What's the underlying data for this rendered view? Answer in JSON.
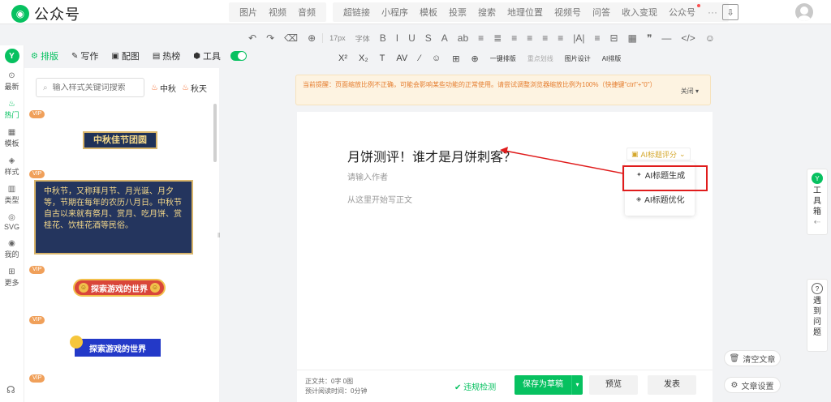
{
  "brand": {
    "name": "公众号"
  },
  "topnav": {
    "group1": [
      "图片",
      "视频",
      "音频"
    ],
    "group2": [
      "超链接",
      "小程序",
      "模板",
      "投票",
      "搜索",
      "地理位置",
      "视频号",
      "问答",
      "收入变现",
      "公众号"
    ],
    "more": "···"
  },
  "toolbar1": {
    "font_size": "17px",
    "font_family": "字体",
    "items": [
      "↶",
      "↷",
      "⌫",
      "⊕",
      "B",
      "I",
      "U",
      "S",
      "A",
      "ab",
      "≡",
      "≣",
      "≡",
      "≡",
      "≡",
      "≡",
      "|A|",
      "≡",
      "⊟",
      "▦",
      "❞",
      "—",
      "</>",
      "☺"
    ]
  },
  "toolbar2": {
    "items": [
      "X²",
      "X₂",
      "T",
      "AV",
      "⁄",
      "☺",
      "⊞",
      "⊕"
    ],
    "onekey": "一键排版",
    "restore": "重点划线",
    "image_design": "图片设计",
    "ai_layout": "AI排版"
  },
  "leftrail": {
    "items": [
      {
        "label": "最新",
        "icon": "⊙"
      },
      {
        "label": "热门",
        "icon": "♨"
      },
      {
        "label": "模板",
        "icon": "▦"
      },
      {
        "label": "样式",
        "icon": "◈"
      },
      {
        "label": "类型",
        "icon": "▥"
      },
      {
        "label": "SVG",
        "icon": "◎"
      },
      {
        "label": "我的",
        "icon": "◉"
      },
      {
        "label": "更多",
        "icon": "⊞"
      }
    ],
    "active": "热门"
  },
  "panel_tabs": [
    {
      "label": "排版",
      "icon": "⚙",
      "active": true
    },
    {
      "label": "写作",
      "icon": "✎"
    },
    {
      "label": "配图",
      "icon": "▣"
    },
    {
      "label": "热榜",
      "icon": "▤"
    },
    {
      "label": "工具",
      "icon": "⬢"
    }
  ],
  "search": {
    "placeholder": "输入样式关键词搜索"
  },
  "hot_tags": [
    "中秋",
    "秋天"
  ],
  "templates": {
    "vip": "VIP",
    "banner1": "中秋佳节团圆",
    "card2": "中秋节，又称拜月节、月光诞、月夕等，节期在每年的农历八月日。中秋节自古以来就有祭月、赏月、吃月饼、赏桂花、饮桂花酒等民俗。",
    "banner3": "探索游戏的世界",
    "banner4": "探索游戏的世界"
  },
  "notice": {
    "text": "当前提醒：页面缩放比例不正确，可能会影响某些功能的正常使用。请尝试调整浏览器缩放比例为100%（快捷键\"ctrl\"+\"0\"）",
    "close": "关闭 ▾"
  },
  "editor": {
    "title": "月饼测评！谁才是月饼刺客？",
    "author_placeholder": "请输入作者",
    "body_placeholder": "从这里开始写正文"
  },
  "ai": {
    "score_label": "AI标题评分",
    "menu": [
      {
        "label": "AI标题生成",
        "icon": "✦"
      },
      {
        "label": "AI标题优化",
        "icon": "◈"
      }
    ]
  },
  "footer": {
    "stats_line1": "正文共：0字 0图",
    "stats_line2": "预计阅读时间：0分钟",
    "check": "违规检测",
    "save": "保存为草稿",
    "preview": "预览",
    "publish": "发表"
  },
  "side_buttons": {
    "clear": "清空文章",
    "settings": "文章设置"
  },
  "right_dock": {
    "toolbox": [
      "工",
      "具",
      "箱"
    ],
    "problem": [
      "遇",
      "到",
      "问",
      "题"
    ]
  }
}
